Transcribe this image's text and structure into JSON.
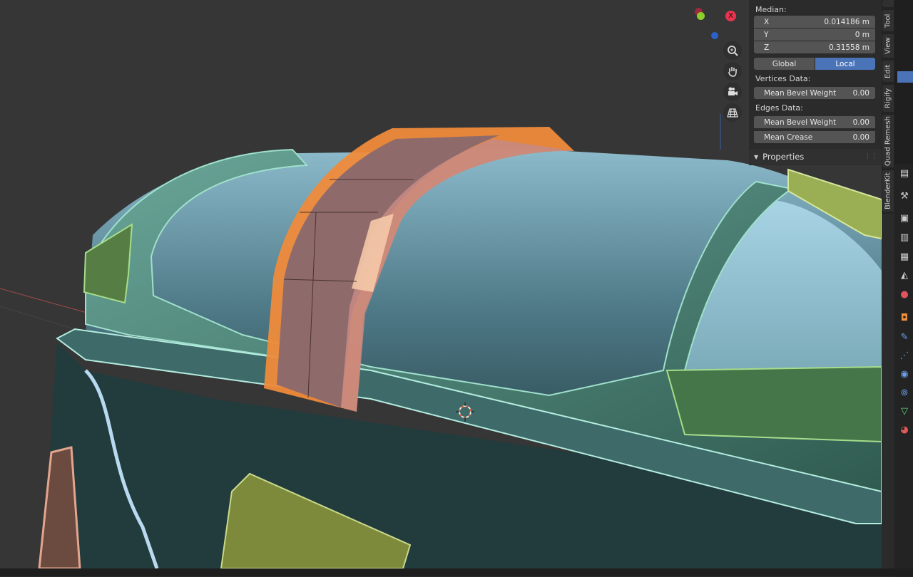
{
  "npanel": {
    "median_label": "Median:",
    "x_label": "X",
    "x_value": "0.014186 m",
    "y_label": "Y",
    "y_value": "0 m",
    "z_label": "Z",
    "z_value": "0.31558 m",
    "global_label": "Global",
    "local_label": "Local",
    "vertices_data_label": "Vertices Data:",
    "vert_bevel_label": "Mean Bevel Weight",
    "vert_bevel_value": "0.00",
    "edges_data_label": "Edges Data:",
    "edge_bevel_label": "Mean Bevel Weight",
    "edge_bevel_value": "0.00",
    "crease_label": "Mean Crease",
    "crease_value": "0.00",
    "properties_label": "Properties"
  },
  "vtabs": [
    "Tool",
    "View",
    "Edit",
    "Rigify",
    "Quad Remesh",
    "BlenderKit"
  ],
  "gizmo": {
    "x_axis_label": "X",
    "x_color": "#e8344f",
    "y_color": "#8ccf2c",
    "z_color": "#2b61c9"
  },
  "navigation": [
    "zoom-icon",
    "hand-pan-icon",
    "camera-icon",
    "grid-ortho-icon"
  ],
  "properties_tabs": [
    "tool-icon",
    "render-icon",
    "output-icon",
    "view-layer-icon",
    "scene-icon",
    "world-icon",
    "object-icon",
    "modifier-icon",
    "particles-icon",
    "physics-icon",
    "constraints-icon",
    "data-icon",
    "material-icon"
  ],
  "colors": {
    "accent": "#4b74b8",
    "selection": "#ef8b3b"
  }
}
